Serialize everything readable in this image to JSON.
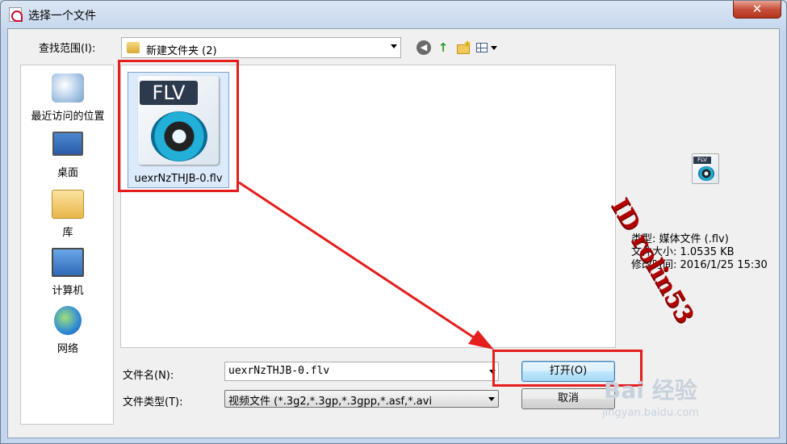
{
  "window": {
    "title": "选择一个文件",
    "close_label": "✕"
  },
  "lookin": {
    "label": "查找范围(I):",
    "value": "新建文件夹 (2)"
  },
  "places": [
    {
      "label": "最近访问的位置",
      "icon": "recent-places-icon"
    },
    {
      "label": "桌面",
      "icon": "desktop-icon"
    },
    {
      "label": "库",
      "icon": "library-icon"
    },
    {
      "label": "计算机",
      "icon": "computer-icon"
    },
    {
      "label": "网络",
      "icon": "network-icon"
    }
  ],
  "files": [
    {
      "name": "uexrNzTHJB-0.flv",
      "badge": "FLV"
    }
  ],
  "filename": {
    "label": "文件名(N):",
    "value": "uexrNzTHJB-0.flv"
  },
  "filetype": {
    "label": "文件类型(T):",
    "value": "视频文件 (*.3g2,*.3gp,*.3gpp,*.asf,*.avi"
  },
  "buttons": {
    "open": "打开(O)",
    "cancel": "取消"
  },
  "preview": {
    "badge": "FLV",
    "type_line": "类型: 媒体文件 (.flv)",
    "size_line": "文件大小: 1.0535 KB",
    "modified_line": "修改时间: 2016/1/25 15:30"
  },
  "watermarks": {
    "id_text": "ID rolin53",
    "baidu_text": "Bai 经验",
    "baidu_url": "jingyan.baidu.com"
  },
  "colors": {
    "annotation": "#e51d1d",
    "selection": "#dcebfc"
  }
}
